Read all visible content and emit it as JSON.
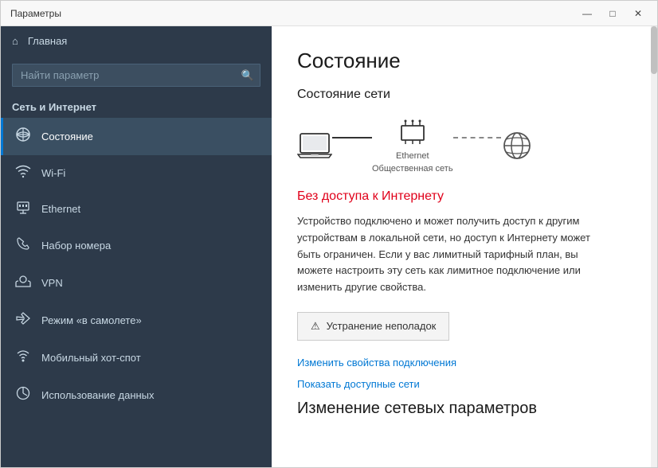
{
  "window": {
    "title": "Параметры",
    "controls": {
      "minimize": "—",
      "maximize": "□",
      "close": "✕"
    }
  },
  "sidebar": {
    "search_placeholder": "Найти параметр",
    "home_label": "Главная",
    "section_label": "Сеть и Интернет",
    "items": [
      {
        "id": "status",
        "icon": "🌐",
        "label": "Состояние",
        "active": true
      },
      {
        "id": "wifi",
        "icon": "📶",
        "label": "Wi-Fi",
        "active": false
      },
      {
        "id": "ethernet",
        "icon": "🔌",
        "label": "Ethernet",
        "active": false
      },
      {
        "id": "dialup",
        "icon": "📞",
        "label": "Набор номера",
        "active": false
      },
      {
        "id": "vpn",
        "icon": "🔒",
        "label": "VPN",
        "active": false
      },
      {
        "id": "airplane",
        "icon": "✈",
        "label": "Режим «в самолете»",
        "active": false
      },
      {
        "id": "hotspot",
        "icon": "📡",
        "label": "Мобильный хот-спот",
        "active": false
      },
      {
        "id": "datausage",
        "icon": "📊",
        "label": "Использование данных",
        "active": false
      }
    ]
  },
  "main": {
    "page_title": "Состояние",
    "network_status_title": "Состояние сети",
    "ethernet_label": "Ethernet",
    "network_type_label": "Общественная сеть",
    "no_internet_label": "Без доступа к Интернету",
    "status_description": "Устройство подключено и может получить доступ к другим устройствам в локальной сети, но доступ к Интернету может быть ограничен. Если у вас лимитный тарифный план, вы можете настроить эту сеть как лимитное подключение или изменить другие свойства.",
    "troubleshoot_btn": "Устранение неполадок",
    "link_change": "Изменить свойства подключения",
    "link_networks": "Показать доступные сети",
    "section_change_title": "Изменение сетевых параметров"
  }
}
